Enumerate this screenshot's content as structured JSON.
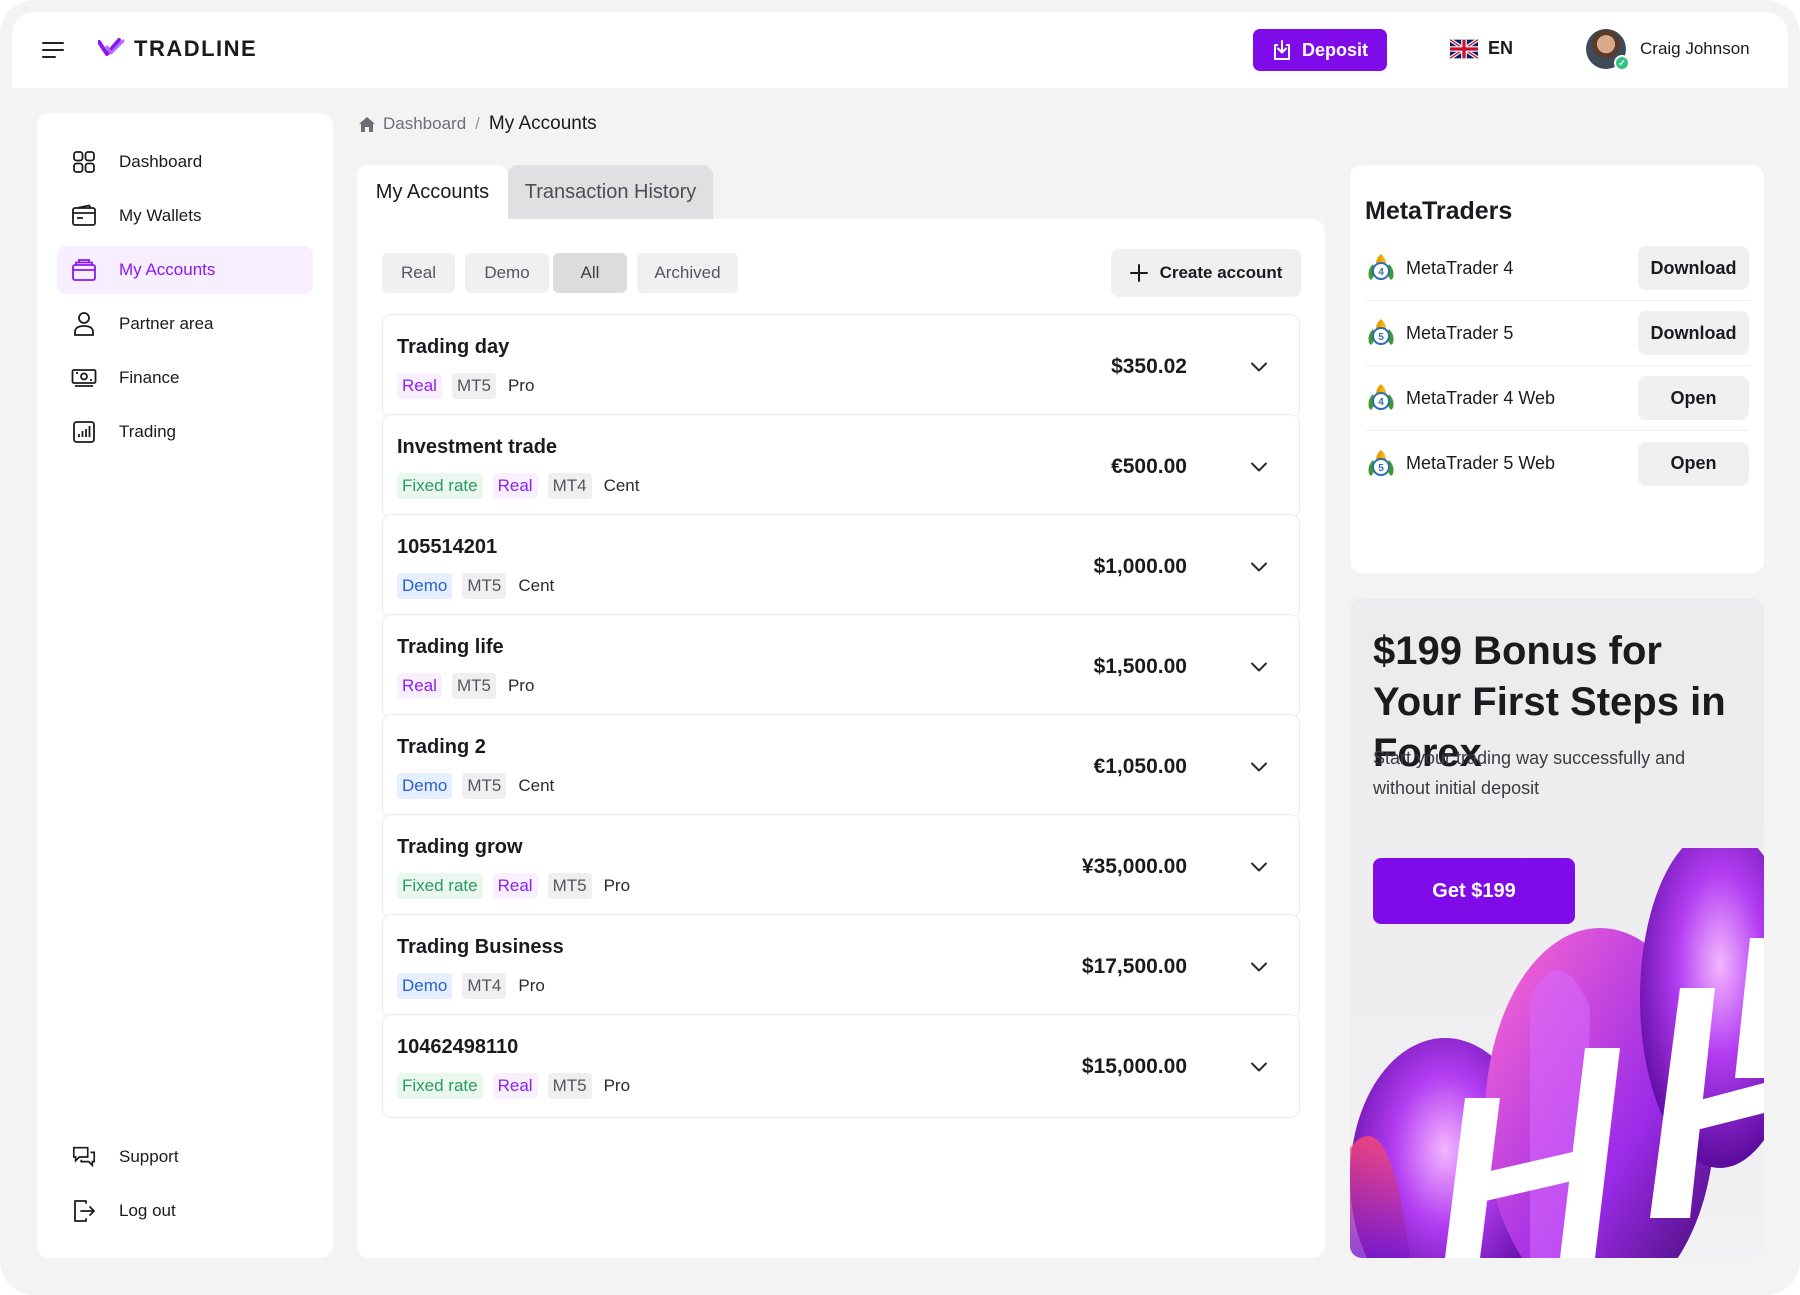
{
  "brand": {
    "name": "TRADLINE",
    "accent": "#7f0ce8"
  },
  "header": {
    "deposit_label": "Deposit",
    "language": "EN",
    "user_name": "Craig Johnson"
  },
  "sidebar": {
    "items": [
      {
        "label": "Dashboard",
        "icon": "grid-icon"
      },
      {
        "label": "My Wallets",
        "icon": "wallet-icon"
      },
      {
        "label": "My Accounts",
        "icon": "accounts-icon",
        "active": true
      },
      {
        "label": "Partner area",
        "icon": "person-icon"
      },
      {
        "label": "Finance",
        "icon": "money-icon"
      },
      {
        "label": "Trading",
        "icon": "chart-icon"
      }
    ],
    "bottom": [
      {
        "label": "Support",
        "icon": "chat-icon"
      },
      {
        "label": "Log out",
        "icon": "logout-icon"
      }
    ]
  },
  "breadcrumb": {
    "home": "Dashboard",
    "separator": "/",
    "current": "My Accounts"
  },
  "tabs": [
    {
      "label": "My Accounts",
      "active": true
    },
    {
      "label": "Transaction History",
      "active": false
    }
  ],
  "filters": [
    {
      "label": "Real"
    },
    {
      "label": "Demo"
    },
    {
      "label": "All",
      "selected": true
    },
    {
      "label": "Archived"
    }
  ],
  "create_account_label": "Create account",
  "accounts": [
    {
      "name": "Trading day",
      "tags": [
        [
          "Real",
          "real"
        ],
        [
          "MT5",
          "plat"
        ],
        [
          "Pro",
          "type"
        ]
      ],
      "balance": "$350.02"
    },
    {
      "name": "Investment trade",
      "tags": [
        [
          "Fixed rate",
          "fixed"
        ],
        [
          "Real",
          "real"
        ],
        [
          "MT4",
          "plat"
        ],
        [
          "Cent",
          "type"
        ]
      ],
      "balance": "€500.00"
    },
    {
      "name": "105514201",
      "tags": [
        [
          "Demo",
          "demo"
        ],
        [
          "MT5",
          "plat"
        ],
        [
          "Cent",
          "type"
        ]
      ],
      "balance": "$1,000.00"
    },
    {
      "name": "Trading life",
      "tags": [
        [
          "Real",
          "real"
        ],
        [
          "MT5",
          "plat"
        ],
        [
          "Pro",
          "type"
        ]
      ],
      "balance": "$1,500.00"
    },
    {
      "name": "Trading 2",
      "tags": [
        [
          "Demo",
          "demo"
        ],
        [
          "MT5",
          "plat"
        ],
        [
          "Cent",
          "type"
        ]
      ],
      "balance": "€1,050.00"
    },
    {
      "name": "Trading grow",
      "tags": [
        [
          "Fixed rate",
          "fixed"
        ],
        [
          "Real",
          "real"
        ],
        [
          "MT5",
          "plat"
        ],
        [
          "Pro",
          "type"
        ]
      ],
      "balance": "¥35,000.00"
    },
    {
      "name": "Trading Business",
      "tags": [
        [
          "Demo",
          "demo"
        ],
        [
          "MT4",
          "plat"
        ],
        [
          "Pro",
          "type"
        ]
      ],
      "balance": "$17,500.00"
    },
    {
      "name": "10462498110",
      "tags": [
        [
          "Fixed rate",
          "fixed"
        ],
        [
          "Real",
          "real"
        ],
        [
          "MT5",
          "plat"
        ],
        [
          "Pro",
          "type"
        ]
      ],
      "balance": "$15,000.00"
    }
  ],
  "metatraders": {
    "title": "MetaTraders",
    "items": [
      {
        "name": "MetaTrader 4",
        "badge": "4",
        "action": "Download"
      },
      {
        "name": "MetaTrader 5",
        "badge": "5",
        "action": "Download"
      },
      {
        "name": "MetaTrader 4 Web",
        "badge": "4",
        "action": "Open"
      },
      {
        "name": "MetaTrader 5 Web",
        "badge": "5",
        "action": "Open"
      }
    ]
  },
  "promo": {
    "title": "$199 Bonus for Your First Steps in Forex",
    "text": "Start your trading way successfully and without initial deposit",
    "button": "Get $199"
  }
}
